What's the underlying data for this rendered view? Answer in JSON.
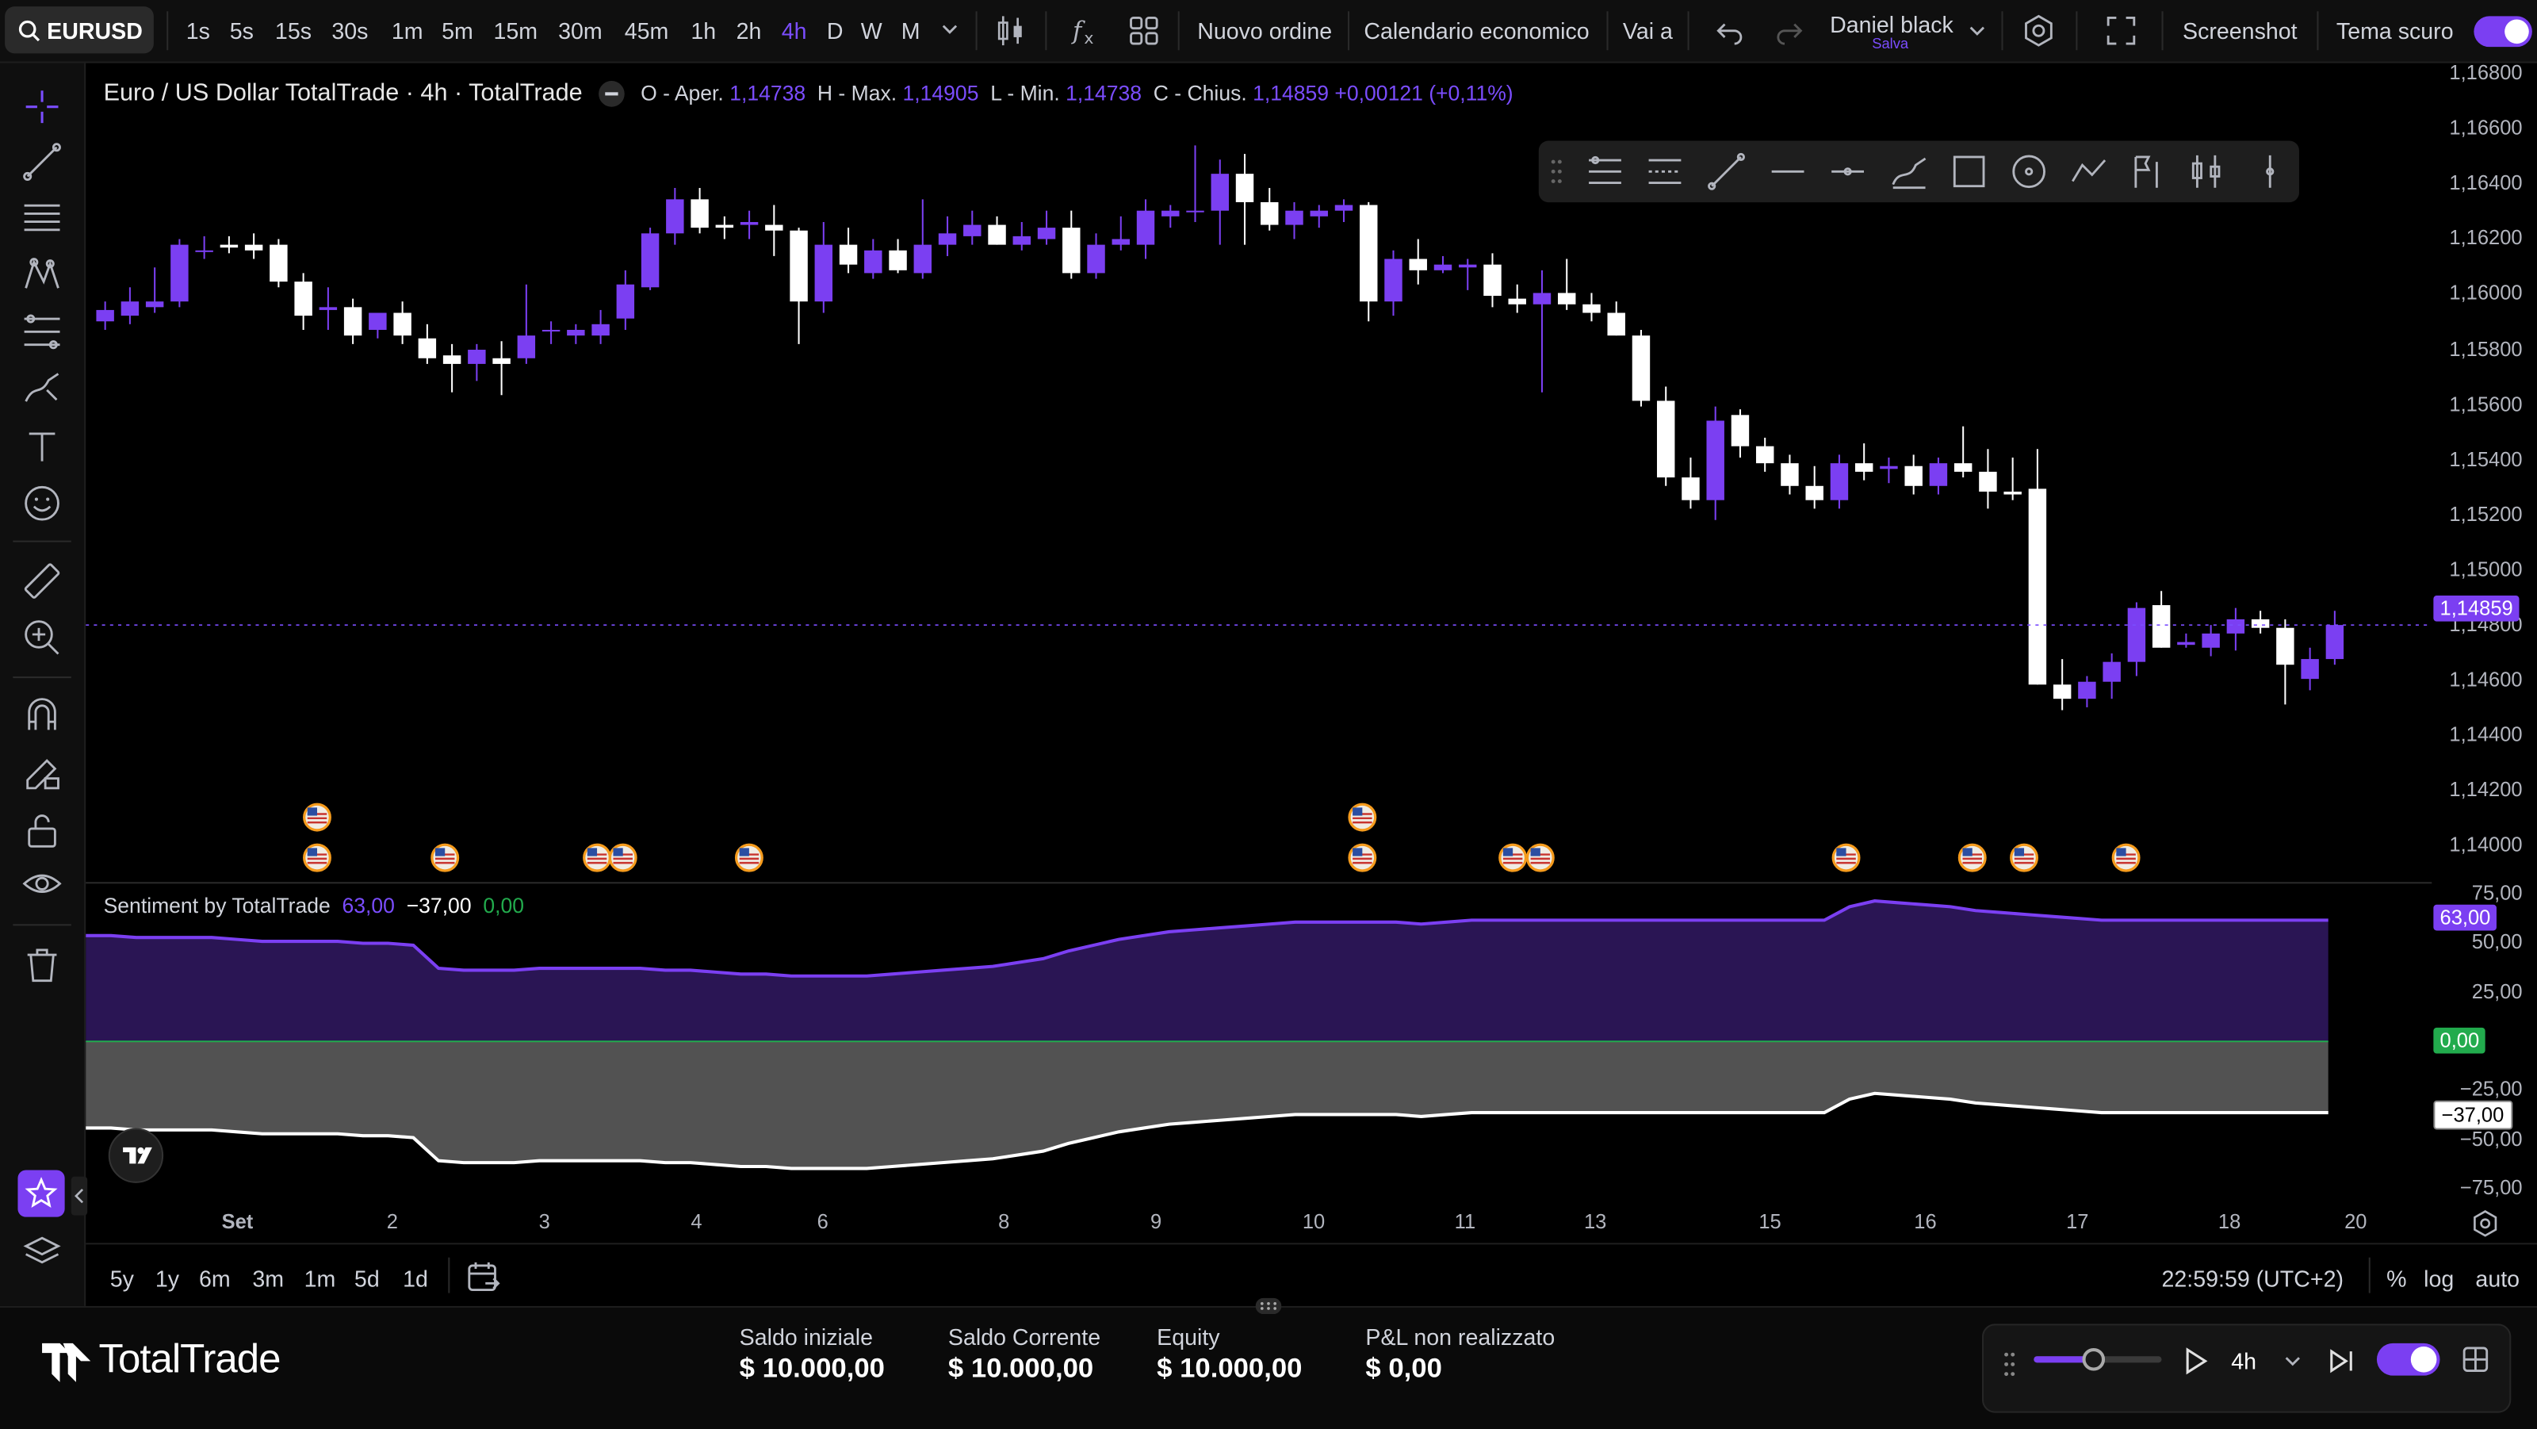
{
  "topbar": {
    "symbol": "EURUSD",
    "intervals": [
      "1s",
      "5s",
      "15s",
      "30s",
      "1m",
      "5m",
      "15m",
      "30m",
      "45m",
      "1h",
      "2h",
      "4h",
      "D",
      "W",
      "M"
    ],
    "active_interval": "4h",
    "new_order": "Nuovo ordine",
    "calendar": "Calendario economico",
    "goto": "Vai a",
    "user_name": "Daniel black",
    "save_label": "Salva",
    "screenshot": "Screenshot",
    "dark_theme": "Tema scuro"
  },
  "legend": {
    "title": "Euro / US Dollar TotalTrade · 4h · TotalTrade",
    "open_label": "O - Aper.",
    "open": "1,14738",
    "high_label": "H - Max.",
    "high": "1,14905",
    "low_label": "L - Min.",
    "low": "1,14738",
    "close_label": "C - Chius.",
    "close": "1,14859",
    "change": "+0,00121 (+0,11%)"
  },
  "price_axis": {
    "ticks": [
      "1,16800",
      "1,16600",
      "1,16400",
      "1,16200",
      "1,16000",
      "1,15800",
      "1,15600",
      "1,15400",
      "1,15200",
      "1,15000",
      "1,14800",
      "1,14600",
      "1,14400",
      "1,14200",
      "1,14000"
    ],
    "current_price": "1,14859"
  },
  "indicator": {
    "name": "Sentiment by TotalTrade",
    "v1": "63,00",
    "v2": "−37,00",
    "v3": "0,00",
    "ticks": [
      "75,00",
      "50,00",
      "25,00",
      "−25,00",
      "−50,00",
      "−75,00"
    ],
    "badge_pos": "63,00",
    "badge_zero": "0,00",
    "badge_neg": "−37,00"
  },
  "time_axis": {
    "labels": [
      "Set",
      "2",
      "3",
      "4",
      "6",
      "8",
      "9",
      "10",
      "11",
      "13",
      "15",
      "16",
      "17",
      "18",
      "20"
    ]
  },
  "ranges": {
    "items": [
      "5y",
      "1y",
      "6m",
      "3m",
      "1m",
      "5d",
      "1d"
    ],
    "clock": "22:59:59 (UTC+2)",
    "percent": "%",
    "log": "log",
    "auto": "auto"
  },
  "footer": {
    "brand": "TotalTrade",
    "stats": [
      {
        "label": "Saldo iniziale",
        "value": "$ 10.000,00"
      },
      {
        "label": "Saldo Corrente",
        "value": "$ 10.000,00"
      },
      {
        "label": "Equity",
        "value": "$ 10.000,00"
      },
      {
        "label": "P&L non realizzato",
        "value": "$ 0,00"
      }
    ],
    "replay_interval": "4h"
  },
  "colors": {
    "bull": "#7b3ff2",
    "bear": "#ffffff",
    "accent": "#7b4dff",
    "zero_badge": "#22ab4d"
  },
  "chart_data": {
    "type": "candlestick",
    "series_open_high_low_close": [
      [
        1.1593,
        1.16,
        1.159,
        1.1597
      ],
      [
        1.1595,
        1.1605,
        1.1592,
        1.16
      ],
      [
        1.1598,
        1.1612,
        1.1596,
        1.16
      ],
      [
        1.16,
        1.1622,
        1.1598,
        1.162
      ],
      [
        1.1618,
        1.1623,
        1.1615,
        1.1618
      ],
      [
        1.162,
        1.1623,
        1.1617,
        1.1619
      ],
      [
        1.162,
        1.1624,
        1.1615,
        1.1618
      ],
      [
        1.162,
        1.1622,
        1.1605,
        1.1607
      ],
      [
        1.1607,
        1.161,
        1.159,
        1.1595
      ],
      [
        1.1597,
        1.1605,
        1.159,
        1.1598
      ],
      [
        1.1598,
        1.1601,
        1.1585,
        1.1588
      ],
      [
        1.159,
        1.1595,
        1.1587,
        1.1596
      ],
      [
        1.1596,
        1.16,
        1.1585,
        1.1588
      ],
      [
        1.1587,
        1.1592,
        1.1578,
        1.158
      ],
      [
        1.1581,
        1.1585,
        1.1568,
        1.1578
      ],
      [
        1.1578,
        1.1585,
        1.1572,
        1.1583
      ],
      [
        1.158,
        1.1586,
        1.1567,
        1.1578
      ],
      [
        1.158,
        1.1606,
        1.1578,
        1.1588
      ],
      [
        1.159,
        1.1593,
        1.1585,
        1.159
      ],
      [
        1.1588,
        1.1592,
        1.1585,
        1.159
      ],
      [
        1.1588,
        1.1597,
        1.1585,
        1.1592
      ],
      [
        1.1594,
        1.1611,
        1.159,
        1.1606
      ],
      [
        1.1605,
        1.1626,
        1.1604,
        1.1624
      ],
      [
        1.1624,
        1.164,
        1.162,
        1.1636
      ],
      [
        1.1636,
        1.164,
        1.1624,
        1.1626
      ],
      [
        1.1627,
        1.163,
        1.1622,
        1.1626
      ],
      [
        1.1627,
        1.1632,
        1.1622,
        1.1628
      ],
      [
        1.1627,
        1.1634,
        1.1616,
        1.1625
      ],
      [
        1.1625,
        1.1626,
        1.1585,
        1.16
      ],
      [
        1.16,
        1.1628,
        1.1596,
        1.162
      ],
      [
        1.162,
        1.1626,
        1.161,
        1.1613
      ],
      [
        1.161,
        1.1622,
        1.1608,
        1.1618
      ],
      [
        1.1618,
        1.1622,
        1.161,
        1.1611
      ],
      [
        1.161,
        1.1636,
        1.1608,
        1.162
      ],
      [
        1.162,
        1.163,
        1.1616,
        1.1624
      ],
      [
        1.1623,
        1.1632,
        1.162,
        1.1627
      ],
      [
        1.1627,
        1.163,
        1.162,
        1.162
      ],
      [
        1.162,
        1.1628,
        1.1618,
        1.1623
      ],
      [
        1.1622,
        1.1632,
        1.162,
        1.1626
      ],
      [
        1.1626,
        1.1632,
        1.1608,
        1.161
      ],
      [
        1.161,
        1.1624,
        1.1608,
        1.162
      ],
      [
        1.162,
        1.163,
        1.1618,
        1.1622
      ],
      [
        1.162,
        1.1636,
        1.1615,
        1.1632
      ],
      [
        1.163,
        1.1634,
        1.1626,
        1.1632
      ],
      [
        1.1632,
        1.1655,
        1.1628,
        1.1632
      ],
      [
        1.1632,
        1.165,
        1.162,
        1.1645
      ],
      [
        1.1645,
        1.1652,
        1.162,
        1.1635
      ],
      [
        1.1635,
        1.164,
        1.1625,
        1.1627
      ],
      [
        1.1627,
        1.1635,
        1.1622,
        1.1632
      ],
      [
        1.163,
        1.1634,
        1.1626,
        1.1632
      ],
      [
        1.1632,
        1.1636,
        1.1628,
        1.1634
      ],
      [
        1.1634,
        1.1635,
        1.1593,
        1.16
      ],
      [
        1.16,
        1.1618,
        1.1595,
        1.1615
      ],
      [
        1.1615,
        1.1622,
        1.1606,
        1.1611
      ],
      [
        1.1611,
        1.1616,
        1.161,
        1.1613
      ],
      [
        1.1612,
        1.1615,
        1.1604,
        1.1613
      ],
      [
        1.1613,
        1.1617,
        1.1598,
        1.1602
      ],
      [
        1.1601,
        1.1606,
        1.1596,
        1.1599
      ],
      [
        1.1599,
        1.1611,
        1.1568,
        1.1603
      ],
      [
        1.1603,
        1.1615,
        1.1597,
        1.1599
      ],
      [
        1.1599,
        1.1603,
        1.1593,
        1.1596
      ],
      [
        1.1596,
        1.16,
        1.1588,
        1.1588
      ],
      [
        1.1588,
        1.159,
        1.1563,
        1.1565
      ],
      [
        1.1565,
        1.157,
        1.1535,
        1.1538
      ],
      [
        1.1538,
        1.1545,
        1.1527,
        1.153
      ],
      [
        1.153,
        1.1563,
        1.1523,
        1.1558
      ],
      [
        1.156,
        1.1562,
        1.1545,
        1.1549
      ],
      [
        1.1549,
        1.1552,
        1.154,
        1.1543
      ],
      [
        1.1543,
        1.1546,
        1.1532,
        1.1535
      ],
      [
        1.1535,
        1.1542,
        1.1527,
        1.153
      ],
      [
        1.153,
        1.1546,
        1.1527,
        1.1543
      ],
      [
        1.1543,
        1.155,
        1.1537,
        1.154
      ],
      [
        1.1541,
        1.1545,
        1.1536,
        1.1542
      ],
      [
        1.1542,
        1.1546,
        1.1532,
        1.1535
      ],
      [
        1.1535,
        1.1545,
        1.1532,
        1.1543
      ],
      [
        1.1543,
        1.1556,
        1.1538,
        1.154
      ],
      [
        1.154,
        1.1548,
        1.1527,
        1.1533
      ],
      [
        1.1533,
        1.1545,
        1.153,
        1.1532
      ],
      [
        1.1534,
        1.1548,
        1.1465,
        1.1465
      ],
      [
        1.1465,
        1.1474,
        1.1456,
        1.146
      ],
      [
        1.146,
        1.1468,
        1.1457,
        1.1466
      ],
      [
        1.1466,
        1.1476,
        1.146,
        1.1473
      ],
      [
        1.1473,
        1.1494,
        1.1468,
        1.1492
      ],
      [
        1.1493,
        1.1498,
        1.1478,
        1.1478
      ],
      [
        1.1479,
        1.1483,
        1.1478,
        1.148
      ],
      [
        1.1478,
        1.1486,
        1.1475,
        1.1483
      ],
      [
        1.1483,
        1.1492,
        1.1477,
        1.1488
      ],
      [
        1.1488,
        1.1491,
        1.1483,
        1.1485
      ],
      [
        1.1485,
        1.1488,
        1.1458,
        1.1472
      ],
      [
        1.1467,
        1.1478,
        1.1463,
        1.1474
      ],
      [
        1.1474,
        1.1491,
        1.1472,
        1.1486
      ]
    ],
    "sentiment_long": [
      55,
      55,
      54,
      54,
      54,
      54,
      53,
      52,
      52,
      52,
      52,
      51,
      51,
      50,
      38,
      37,
      37,
      37,
      38,
      38,
      38,
      38,
      38,
      37,
      37,
      36,
      35,
      35,
      34,
      34,
      34,
      34,
      35,
      36,
      37,
      38,
      39,
      41,
      43,
      47,
      50,
      53,
      55,
      57,
      58,
      59,
      60,
      61,
      62,
      62,
      62,
      62,
      62,
      61,
      62,
      63,
      63,
      63,
      63,
      63,
      63,
      63,
      63,
      63,
      63,
      63,
      63,
      63,
      63,
      63,
      70,
      73,
      72,
      71,
      70,
      68,
      67,
      66,
      65,
      64,
      63,
      63,
      63,
      63,
      63,
      63,
      63,
      63,
      63,
      63
    ],
    "sentiment_short": [
      -45,
      -45,
      -46,
      -46,
      -46,
      -46,
      -47,
      -48,
      -48,
      -48,
      -48,
      -49,
      -49,
      -50,
      -62,
      -63,
      -63,
      -63,
      -62,
      -62,
      -62,
      -62,
      -62,
      -63,
      -63,
      -64,
      -65,
      -65,
      -66,
      -66,
      -66,
      -66,
      -65,
      -64,
      -63,
      -62,
      -61,
      -59,
      -57,
      -53,
      -50,
      -47,
      -45,
      -43,
      -42,
      -41,
      -40,
      -39,
      -38,
      -38,
      -38,
      -38,
      -38,
      -39,
      -38,
      -37,
      -37,
      -37,
      -37,
      -37,
      -37,
      -37,
      -37,
      -37,
      -37,
      -37,
      -37,
      -37,
      -37,
      -37,
      -30,
      -27,
      -28,
      -29,
      -30,
      -32,
      -33,
      -34,
      -35,
      -36,
      -37,
      -37,
      -37,
      -37,
      -37,
      -37,
      -37,
      -37,
      -37,
      -37
    ],
    "price_range": [
      1.1396,
      1.1684
    ],
    "sentiment_range": [
      -82,
      82
    ]
  }
}
